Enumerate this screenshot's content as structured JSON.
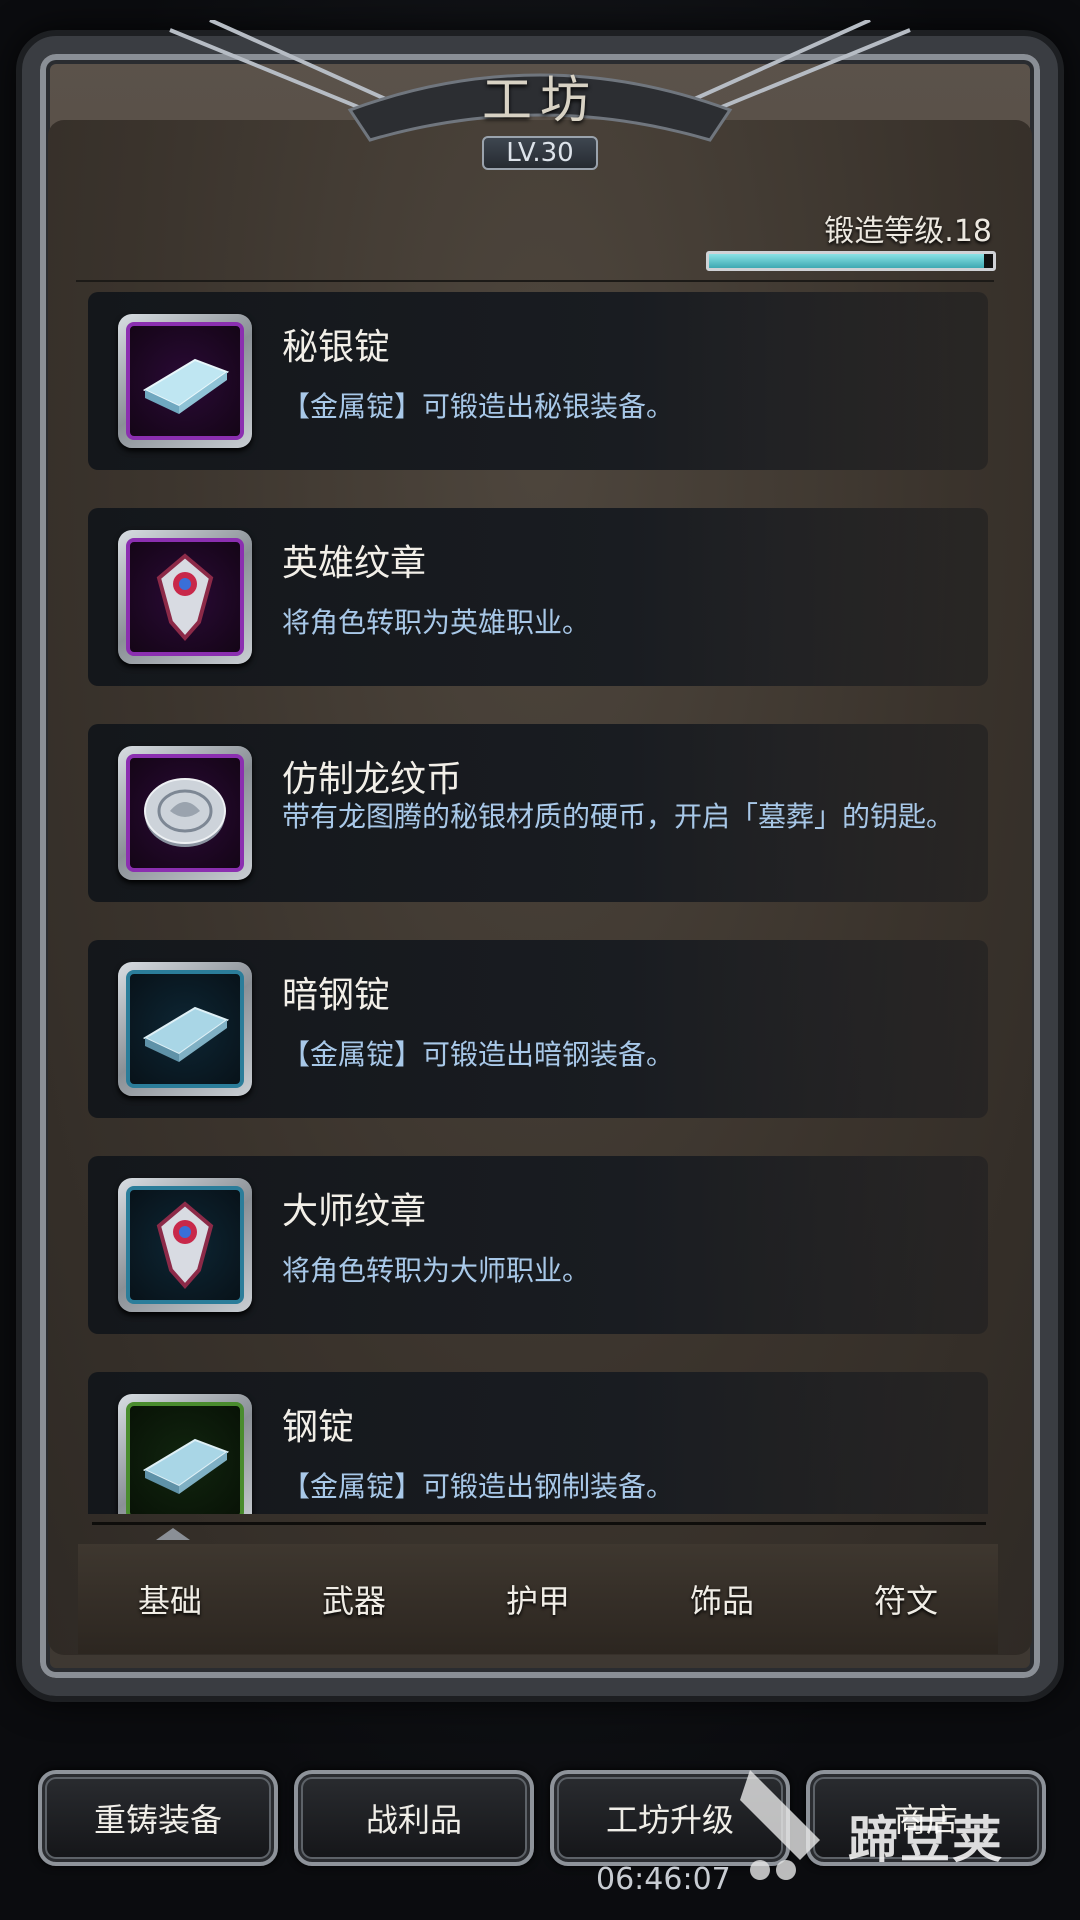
{
  "header": {
    "title": "工坊",
    "level": "LV.30"
  },
  "forge": {
    "label": "锻造等级.18",
    "progress": 0.97
  },
  "items": [
    {
      "name": "秘银锭",
      "desc": "【金属锭】可锻造出秘银装备。",
      "icon": "ingot-icon",
      "frame": "purple"
    },
    {
      "name": "英雄纹章",
      "desc": "将角色转职为英雄职业。",
      "icon": "crest-icon",
      "frame": "purple"
    },
    {
      "name": "仿制龙纹币",
      "desc": "带有龙图腾的秘银材质的硬币，开启「墓葬」的钥匙。",
      "icon": "coin-icon",
      "frame": "purple"
    },
    {
      "name": "暗钢锭",
      "desc": "【金属锭】可锻造出暗钢装备。",
      "icon": "ingot-icon",
      "frame": "teal"
    },
    {
      "name": "大师纹章",
      "desc": "将角色转职为大师职业。",
      "icon": "crest-icon",
      "frame": "teal"
    },
    {
      "name": "钢锭",
      "desc": "【金属锭】可锻造出钢制装备。",
      "icon": "ingot-icon",
      "frame": "green"
    }
  ],
  "tabs": [
    "基础",
    "武器",
    "护甲",
    "饰品",
    "符文"
  ],
  "buttons": [
    "重铸装备",
    "战利品",
    "工坊升级",
    "商店"
  ],
  "clock": "06:46:07",
  "watermark": "蹄豆荚",
  "colors": {
    "accent": "#4fb6be",
    "desc_text": "#a8c8e8"
  }
}
